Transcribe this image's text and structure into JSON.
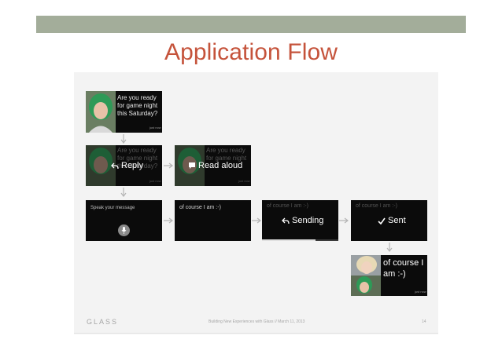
{
  "slide": {
    "title": "Application Flow"
  },
  "cards": {
    "incoming": {
      "message": "Are you ready for game night this Saturday?",
      "timestamp": "just now"
    },
    "reply": {
      "ghost_text": "Are you ready for game night this Saturday?",
      "action": "Reply",
      "timestamp": "just now"
    },
    "read_aloud": {
      "ghost_text": "Are you ready for game night",
      "action": "Read aloud",
      "timestamp": "just now"
    },
    "speak": {
      "prompt": "Speak your message"
    },
    "transcript": {
      "text": "of course I am :-)"
    },
    "sending": {
      "ghost_text": "of course I am :-)",
      "action": "Sending"
    },
    "sent": {
      "ghost_text": "of course I am :-)",
      "action": "Sent"
    },
    "final": {
      "message": "of course I am :-)",
      "timestamp": "just now"
    }
  },
  "footer": {
    "brand": "GLASS",
    "note": "Building New Experiences with Glass // March 11, 2013",
    "page": "14"
  },
  "colors": {
    "title": "#c5533b",
    "top_bar": "#a3ad9a",
    "card_bg": "#0b0b0b",
    "arrow": "#b5b5b5"
  }
}
